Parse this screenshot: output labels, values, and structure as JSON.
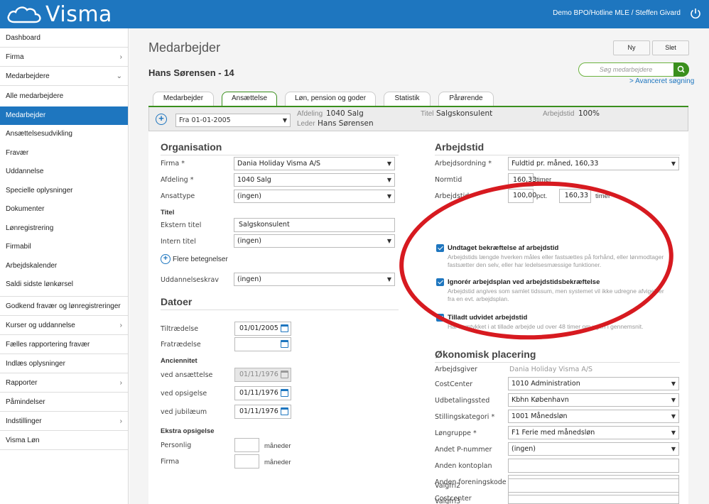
{
  "header": {
    "logo_text": "Visma",
    "user": "Demo BPO/Hotline MLE / Steffen Givard"
  },
  "sidebar": {
    "items": [
      {
        "label": "Dashboard",
        "chevron": ""
      },
      {
        "label": "Firma",
        "chevron": "›"
      },
      {
        "label": "Medarbejdere",
        "chevron": "⌄"
      }
    ],
    "subitems": [
      "Alle medarbejdere",
      "Medarbejder",
      "Ansættelsesudvikling",
      "Fravær",
      "Uddannelse",
      "Specielle oplysninger",
      "Dokumenter",
      "Lønregistrering",
      "Firmabil",
      "Arbejdskalender",
      "Saldi sidste lønkørsel"
    ],
    "bottom_items": [
      {
        "label": "Godkend fravær og lønregistreringer",
        "chevron": ""
      },
      {
        "label": "Kurser og uddannelse",
        "chevron": "›"
      },
      {
        "label": "Fælles rapportering fravær",
        "chevron": ""
      },
      {
        "label": "Indlæs oplysninger",
        "chevron": ""
      },
      {
        "label": "Rapporter",
        "chevron": "›"
      },
      {
        "label": "Påmindelser",
        "chevron": ""
      },
      {
        "label": "Indstillinger",
        "chevron": "›"
      },
      {
        "label": "Visma Løn",
        "chevron": ""
      }
    ]
  },
  "main": {
    "title": "Medarbejder",
    "new_button": "Ny",
    "delete_button": "Slet",
    "employee": "Hans Sørensen - 14",
    "search_placeholder": "Søg medarbejdere",
    "advanced_search": "> Avanceret søgning",
    "tabs": [
      "Medarbejder",
      "Ansættelse",
      "Løn, pension og goder",
      "Statistik",
      "Pårørende"
    ],
    "active_tab": 1
  },
  "infobar": {
    "date": "Fra 01-01-2005",
    "afdeling_label": "Afdeling",
    "afdeling_value": "1040 Salg",
    "leder_label": "Leder",
    "leder_value": "Hans Sørensen",
    "titel_label": "Titel",
    "titel_value": "Salgskonsulent",
    "arbejdstid_label": "Arbejdstid",
    "arbejdstid_value": "100%"
  },
  "organisation": {
    "heading": "Organisation",
    "firma_label": "Firma *",
    "firma_value": "Dania Holiday Visma A/S",
    "afdeling_label": "Afdeling *",
    "afdeling_value": "1040 Salg",
    "ansattype_label": "Ansattype",
    "ansattype_value": "(ingen)",
    "titel_heading": "Titel",
    "ekstern_label": "Ekstern titel",
    "ekstern_value": "Salgskonsulent",
    "intern_label": "Intern titel",
    "intern_value": "(ingen)",
    "flere": "Flere betegnelser",
    "uddannelse_label": "Uddannelseskrav",
    "uddannelse_value": "(ingen)"
  },
  "datoer": {
    "heading": "Datoer",
    "tiltraedelse_label": "Tiltrædelse",
    "tiltraedelse_value": "01/01/2005",
    "fratraedelse_label": "Fratrædelse",
    "fratraedelse_value": "",
    "anciennitet_heading": "Anciennitet",
    "ansaettelse_label": "ved ansættelse",
    "ansaettelse_value": "01/11/1976",
    "opsigelse_label": "ved opsigelse",
    "opsigelse_value": "01/11/1976",
    "jubilaeum_label": "ved jubilæum",
    "jubilaeum_value": "01/11/1976",
    "ekstra_heading": "Ekstra opsigelse",
    "personlig_label": "Personlig",
    "firma_label": "Firma",
    "maaneder": "måneder"
  },
  "arbejdstid": {
    "heading": "Arbejdstid",
    "ordning_label": "Arbejdsordning *",
    "ordning_value": "Fuldtid pr. måned, 160,33",
    "normtid_label": "Normtid",
    "normtid_value": "160,33",
    "normtid_unit": "timer",
    "arbejdstid_label": "Arbejdstid",
    "pct_value": "100,00",
    "pct_unit": "pct.",
    "timer_value": "160,33",
    "timer_unit": "timer",
    "checks": [
      {
        "title": "Undtaget bekræftelse af arbejdstid",
        "desc": "Arbejdstids længde hverken måles eller fastsættes på forhånd, eller lønmodtager fastsætter den selv, eller har ledelsesmæssige funktioner."
      },
      {
        "title": "Ignorér arbejdsplan ved arbejdstidsbekræftelse",
        "desc": "Arbejdstid angives som samlet tidssum, men systemet vil ikke udregne afvigelser fra en evt. arbejdsplan."
      },
      {
        "title": "Tilladt udvidet arbejdstid",
        "desc": "Har samtykket i at tillade arbejde ud over 48 timer om ugen i gennemsnit."
      }
    ]
  },
  "okonomi": {
    "heading": "Økonomisk placering",
    "arbejdsgiver_label": "Arbejdsgiver",
    "arbejdsgiver_value": "Dania Holiday Visma A/S",
    "costcenter_label": "CostCenter",
    "costcenter_value": "1010 Administration",
    "udbetaling_label": "Udbetalingssted",
    "udbetaling_value": "Kbhn København",
    "stilling_label": "Stillingskategori *",
    "stilling_value": "1001 Månedsløn",
    "loengruppe_label": "Løngruppe *",
    "loengruppe_value": "F1 Ferie med månedsløn",
    "andet_label": "Andet P-nummer",
    "andet_value": "(ingen)",
    "kontoplan_label": "Anden kontoplan",
    "forening_label": "Anden foreningskode",
    "costcenter2_label": "Costcenter",
    "valgfri2_label": "Valgfri2",
    "valgfri3_label": "Valgfri3"
  },
  "colors": {
    "brand_blue": "#1e76bf",
    "accent_green": "#3a8f1d",
    "annotation_red": "#d71a20"
  }
}
